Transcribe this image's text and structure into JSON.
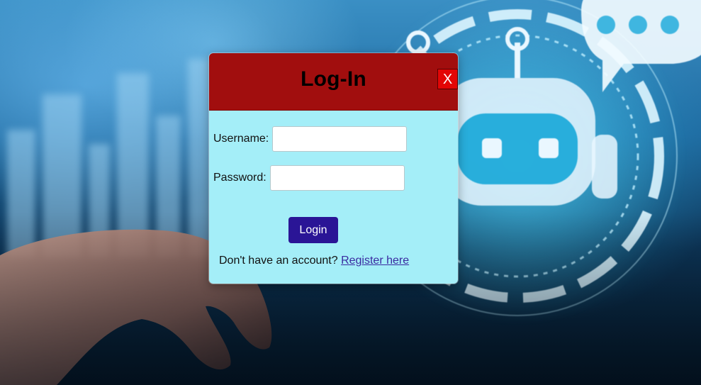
{
  "modal": {
    "title": "Log-In",
    "close_label": "X",
    "username_label": "Username:",
    "username_value": "",
    "password_label": "Password:",
    "password_value": "",
    "login_label": "Login",
    "register_prompt": "Don't have an account?",
    "register_link": "Register here"
  },
  "colors": {
    "header": "#a10e0e",
    "body": "#a4eef8",
    "close": "#e30606",
    "login_button": "#2a1596",
    "link": "#3a2aa0"
  },
  "background": {
    "description_icons": [
      "city-skyline-image",
      "chatbot-robot-icon",
      "chat-bubble-icon",
      "hand-image"
    ]
  }
}
